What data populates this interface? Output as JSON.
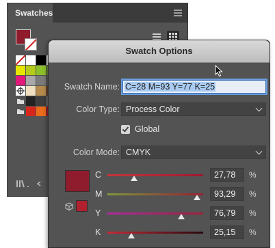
{
  "swatches_panel": {
    "tab": "Swatches",
    "fill_color": "#8e1c2c",
    "grid": [
      [
        "none",
        "#ffffff",
        "#000000",
        "#d9d9d9"
      ],
      [
        "#e8e600",
        "#b6cc1a",
        "#8dbf2a",
        "#6b8f2f"
      ],
      [
        "#e0197a",
        "#a8a8a8",
        "#7a7a7a",
        "#5a5a5a"
      ],
      [
        "registration",
        "#f0e0c0",
        "#b58a4c",
        "#6a3e20"
      ],
      [
        "folder",
        "#222222",
        "#3d3d3d",
        "#6a6a6a"
      ],
      [
        "folder",
        "#d9261c",
        "#ec6b1a",
        "#b01020"
      ]
    ],
    "bottom_icons": [
      "library-icon",
      "swatch-kind-icon"
    ]
  },
  "dialog": {
    "title": "Swatch Options",
    "swatch_name_label": "Swatch Name:",
    "swatch_name_value": "C=28 M=93 Y=77 K=25",
    "color_type_label": "Color Type:",
    "color_type_value": "Process Color",
    "global_label": "Global",
    "global_checked": true,
    "color_mode_label": "Color Mode:",
    "color_mode_value": "CMYK",
    "preview_color": "#8e1c2c",
    "channels": [
      {
        "label": "C",
        "value": "27,78",
        "fraction": 0.2778,
        "gradient": [
          "#c9353a",
          "#a01830"
        ]
      },
      {
        "label": "M",
        "value": "93,29",
        "fraction": 0.9329,
        "gradient": [
          "#7f9a3a",
          "#9a1f2f"
        ]
      },
      {
        "label": "Y",
        "value": "76,79",
        "fraction": 0.7679,
        "gradient": [
          "#b02aa0",
          "#a0203a"
        ]
      },
      {
        "label": "K",
        "value": "25,15",
        "fraction": 0.2515,
        "gradient": [
          "#c82838",
          "#2a0a0e"
        ]
      }
    ],
    "percent_sign": "%"
  }
}
